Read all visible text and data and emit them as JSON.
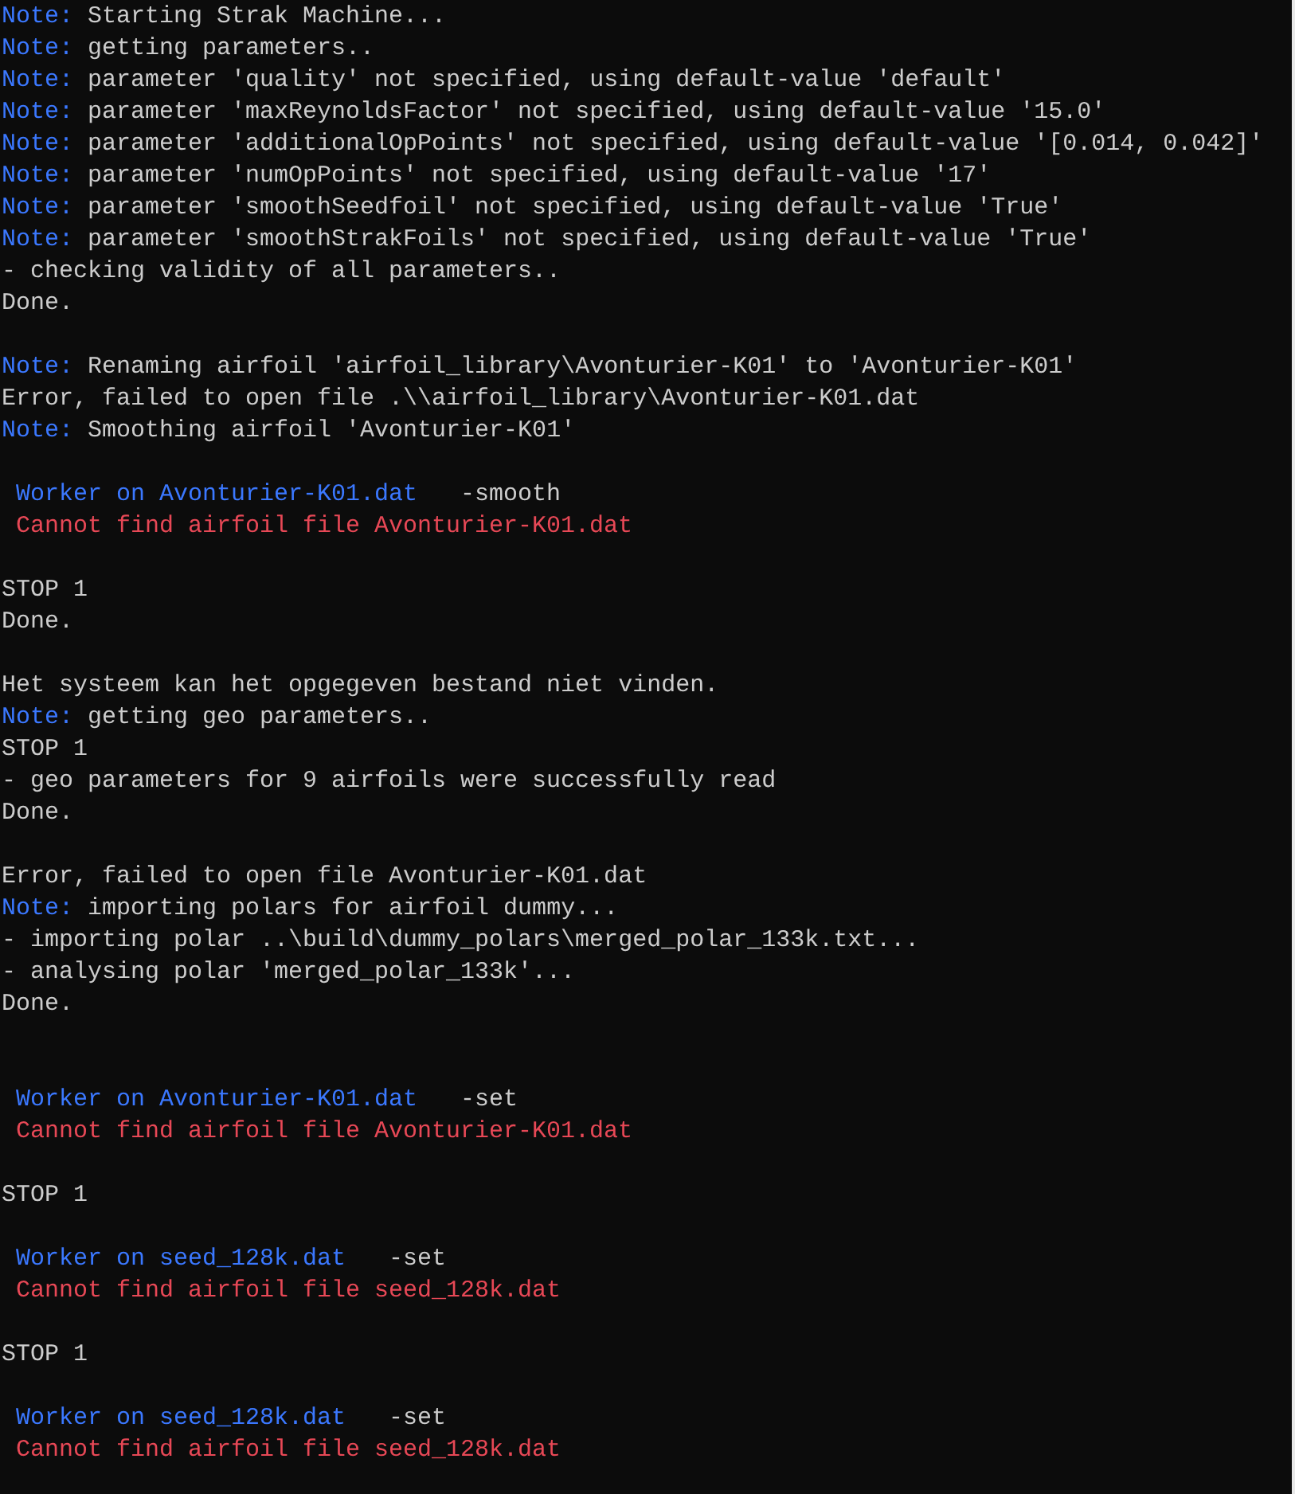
{
  "console": {
    "lines": [
      {
        "kind": "note",
        "label": "Note:",
        "text": "Starting Strak Machine..."
      },
      {
        "kind": "note",
        "label": "Note:",
        "text": "getting parameters.."
      },
      {
        "kind": "note",
        "label": "Note:",
        "text": "parameter 'quality' not specified, using default-value 'default'"
      },
      {
        "kind": "note",
        "label": "Note:",
        "text": "parameter 'maxReynoldsFactor' not specified, using default-value '15.0'"
      },
      {
        "kind": "note",
        "label": "Note:",
        "text": "parameter 'additionalOpPoints' not specified, using default-value '[0.014, 0.042]'"
      },
      {
        "kind": "note",
        "label": "Note:",
        "text": "parameter 'numOpPoints' not specified, using default-value '17'"
      },
      {
        "kind": "note",
        "label": "Note:",
        "text": "parameter 'smoothSeedfoil' not specified, using default-value 'True'"
      },
      {
        "kind": "note",
        "label": "Note:",
        "text": "parameter 'smoothStrakFoils' not specified, using default-value 'True'"
      },
      {
        "kind": "plain",
        "text": "- checking validity of all parameters.."
      },
      {
        "kind": "plain",
        "text": "Done."
      },
      {
        "kind": "blank"
      },
      {
        "kind": "note",
        "label": "Note:",
        "text": "Renaming airfoil 'airfoil_library\\Avonturier-K01' to 'Avonturier-K01'"
      },
      {
        "kind": "plain",
        "text": "Error, failed to open file .\\\\airfoil_library\\Avonturier-K01.dat"
      },
      {
        "kind": "note",
        "label": "Note:",
        "text": "Smoothing airfoil 'Avonturier-K01'"
      },
      {
        "kind": "blank"
      },
      {
        "kind": "worker",
        "text": "Worker on Avonturier-K01.dat",
        "option": "-smooth"
      },
      {
        "kind": "error",
        "text": "Cannot find airfoil file Avonturier-K01.dat"
      },
      {
        "kind": "blank"
      },
      {
        "kind": "plain",
        "text": "STOP 1"
      },
      {
        "kind": "plain",
        "text": "Done."
      },
      {
        "kind": "blank"
      },
      {
        "kind": "plain",
        "text": "Het systeem kan het opgegeven bestand niet vinden."
      },
      {
        "kind": "note",
        "label": "Note:",
        "text": "getting geo parameters.."
      },
      {
        "kind": "plain",
        "text": "STOP 1"
      },
      {
        "kind": "plain",
        "text": "- geo parameters for 9 airfoils were successfully read"
      },
      {
        "kind": "plain",
        "text": "Done."
      },
      {
        "kind": "blank"
      },
      {
        "kind": "plain",
        "text": "Error, failed to open file Avonturier-K01.dat"
      },
      {
        "kind": "note",
        "label": "Note:",
        "text": "importing polars for airfoil dummy..."
      },
      {
        "kind": "plain",
        "text": "- importing polar ..\\build\\dummy_polars\\merged_polar_133k.txt..."
      },
      {
        "kind": "plain",
        "text": "- analysing polar 'merged_polar_133k'..."
      },
      {
        "kind": "plain",
        "text": "Done."
      },
      {
        "kind": "blank"
      },
      {
        "kind": "blank"
      },
      {
        "kind": "worker",
        "text": "Worker on Avonturier-K01.dat",
        "option": "-set"
      },
      {
        "kind": "error",
        "text": "Cannot find airfoil file Avonturier-K01.dat"
      },
      {
        "kind": "blank"
      },
      {
        "kind": "plain",
        "text": "STOP 1"
      },
      {
        "kind": "blank"
      },
      {
        "kind": "worker",
        "text": "Worker on seed_128k.dat",
        "option": "-set"
      },
      {
        "kind": "error",
        "text": "Cannot find airfoil file seed_128k.dat"
      },
      {
        "kind": "blank"
      },
      {
        "kind": "plain",
        "text": "STOP 1"
      },
      {
        "kind": "blank"
      },
      {
        "kind": "worker",
        "text": "Worker on seed_128k.dat",
        "option": "-set"
      },
      {
        "kind": "error",
        "text": "Cannot find airfoil file seed_128k.dat"
      }
    ]
  }
}
